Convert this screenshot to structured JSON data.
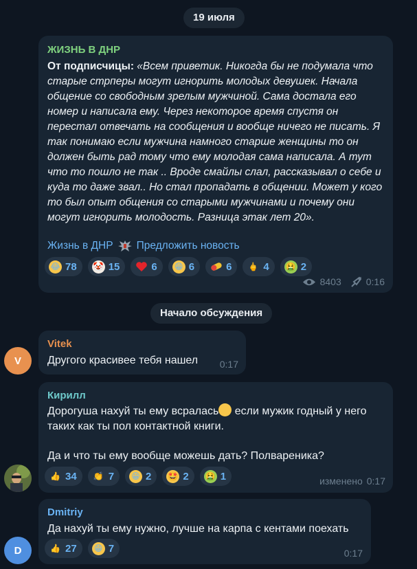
{
  "date_separator": "19 июля",
  "post": {
    "channel_name": "ЖИЗНЬ В ДНР",
    "prefix": "От подписчицы:",
    "text": "«Всем приветик. Никогда бы не подумала что старые стрперы могут игнорить молодых девушек. Начала общение со свободным зрелым мужчиной. Сама достала его номер и написала ему. Через некоторое время спустя он перестал отвечать на сообщения и вообще ничего не писать. Я так понимаю если мужчина намного старше женщины то он должен быть рад тому что ему молодая сама написала. А тут что то пошло не так .. Вроде смайлы слал, рассказывал о себе и куда то даже звал.. Но стал пропадать в общении. Может у кого то был опыт общения со старыми мужчинами и почему они могут игнорить молодость. Разница этак лет 20».",
    "link_channel": "Жизнь в ДНР",
    "link_suggest": "Предложить новость",
    "reactions": [
      {
        "icon": "rofl-emoji-icon",
        "count": "78"
      },
      {
        "icon": "clown-emoji-icon",
        "count": "15"
      },
      {
        "icon": "heart-emoji-icon",
        "count": "6"
      },
      {
        "icon": "grin-emoji-icon",
        "count": "6"
      },
      {
        "icon": "pill-emoji-icon",
        "count": "6"
      },
      {
        "icon": "middle-finger-emoji-icon",
        "count": "4"
      },
      {
        "icon": "vomit-emoji-icon",
        "count": "2"
      }
    ],
    "views": "8403",
    "time": "0:16"
  },
  "discussion_separator": "Начало обсуждения",
  "comments": [
    {
      "author": "Vitek",
      "author_color": "#e8914f",
      "avatar_letter": "V",
      "avatar_color": "#e8914f",
      "text": "Другого красивее тебя нашел",
      "time": "0:17"
    },
    {
      "author": "Кирилл",
      "author_color": "#6ec9cb",
      "text_part1": "Дорогуша нахуй ты ему всралась",
      "text_part2": " если мужик годный у него таких как ты пол контактной книги.",
      "text_line2": "Да и что ты ему вообще можешь дать? Полвареника?",
      "reactions": [
        {
          "icon": "thumbs-up-emoji-icon",
          "count": "34"
        },
        {
          "icon": "clap-emoji-icon",
          "count": "7"
        },
        {
          "icon": "grin-emoji-icon",
          "count": "2"
        },
        {
          "icon": "star-struck-emoji-icon",
          "count": "2"
        },
        {
          "icon": "vomit-emoji-icon",
          "count": "1"
        }
      ],
      "edited_label": "изменено",
      "time": "0:17"
    },
    {
      "author": "Dmitriy",
      "author_color": "#6ab3f3",
      "avatar_letter": "D",
      "avatar_color": "#4f8fe0",
      "text": "Да нахуй ты ему нужно, лучше на карпа с кентами поехать",
      "reactions": [
        {
          "icon": "thumbs-up-emoji-icon",
          "count": "27"
        },
        {
          "icon": "grin-emoji-icon",
          "count": "7"
        }
      ],
      "time": "0:17"
    }
  ]
}
